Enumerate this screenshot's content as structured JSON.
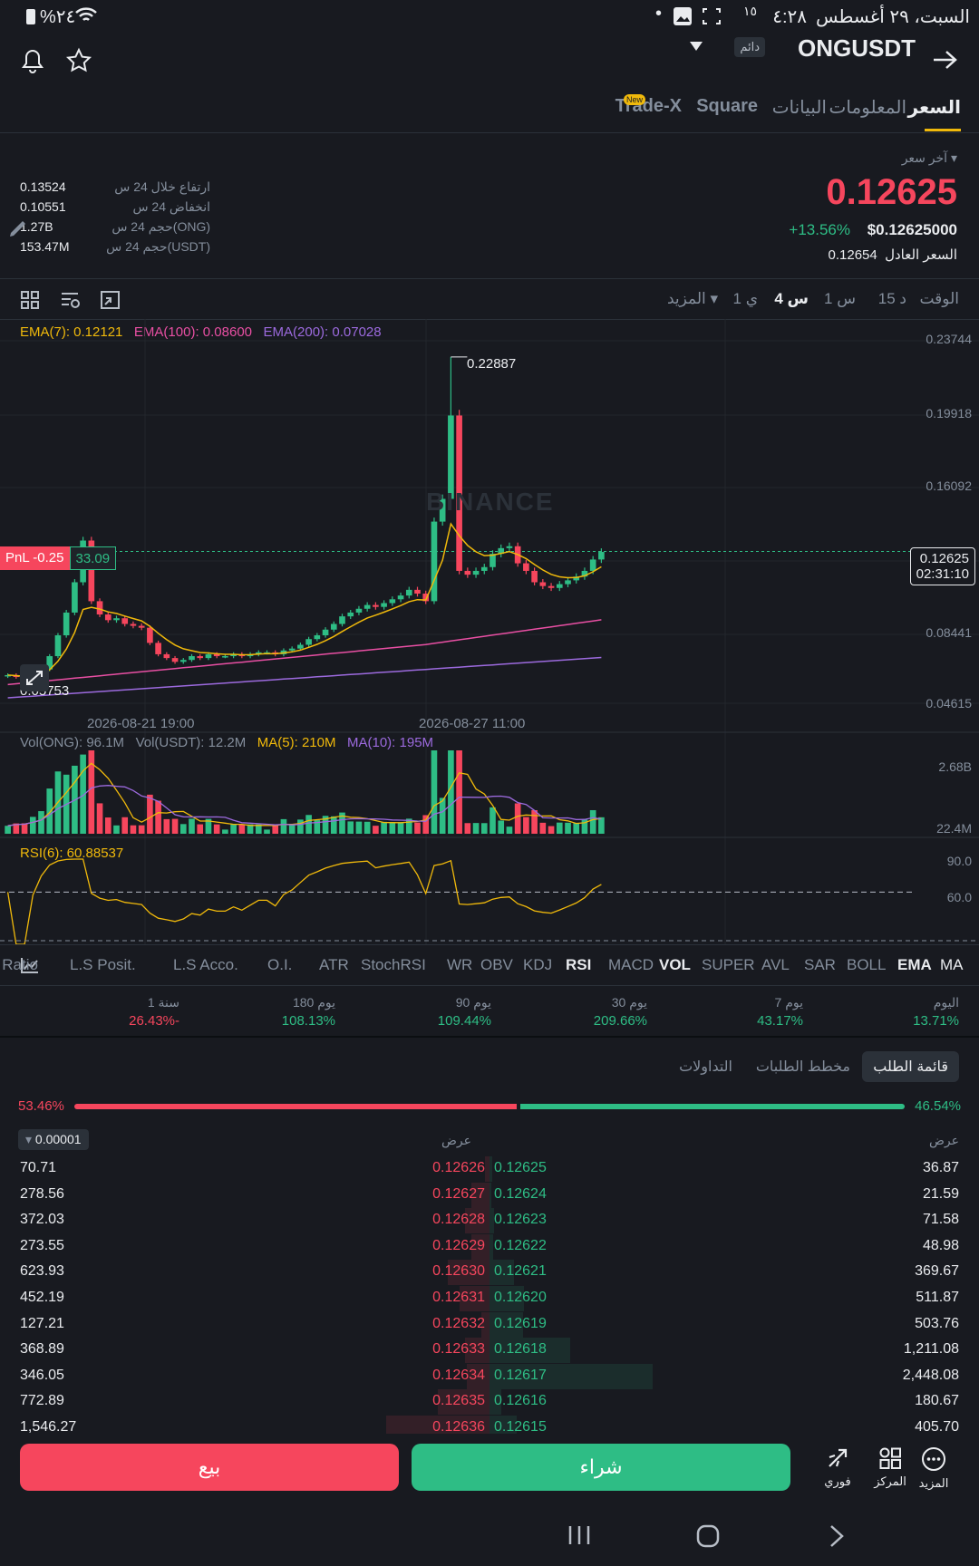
{
  "status_bar": {
    "date": "السبت، ٢٩ أغسطس",
    "time": "٤:٢٨",
    "battery": "%٢٤",
    "sim": "١٥"
  },
  "header": {
    "symbol": "ONGUSDT",
    "badge": "دائم"
  },
  "tabs": [
    {
      "label": "السعر"
    },
    {
      "label": "المعلومات"
    },
    {
      "label": "البيانات"
    },
    {
      "label": "Square"
    },
    {
      "label": "Trade-X",
      "new_badge": "New"
    }
  ],
  "price_panel": {
    "last_price_label": "آخر سعر",
    "last_price": "0.12625",
    "change_pct": "+13.56%",
    "usd_price": "$0.12625000",
    "fair_label": "السعر العادل",
    "fair_price": "0.12654",
    "stats": [
      {
        "label": "ارتفاع خلال 24 س",
        "value": "0.13524"
      },
      {
        "label": "انخفاض 24 س",
        "value": "0.10551"
      },
      {
        "label": "حجم 24 س(ONG)",
        "value": "1.27B"
      },
      {
        "label": "حجم 24 س(USDT)",
        "value": "153.47M"
      }
    ]
  },
  "timeframes": {
    "time_label": "الوقت",
    "items": [
      "15 د",
      "1 س",
      "4 س",
      "1 ي"
    ],
    "active": "4 س",
    "more": "المزيد"
  },
  "chart": {
    "ema_labels": [
      "EMA(7): 0.12121",
      "EMA(100): 0.08600",
      "EMA(200): 0.07028"
    ],
    "y_ticks": [
      "0.23744",
      "0.19918",
      "0.16092",
      "0.08441",
      "0.04615"
    ],
    "high_marker": "0.22887",
    "low_marker": "0.05753",
    "current_price": "0.12625",
    "countdown": "02:31:10",
    "pnl_label": "PnL -0.25",
    "pnl_value": "33.09",
    "x_ticks": [
      "2026-08-21 19:00",
      "2026-08-27 11:00"
    ],
    "watermark": "BINANCE",
    "vol_labels": [
      "Vol(ONG): 96.1M",
      "Vol(USDT): 12.2M",
      "MA(5): 210M",
      "MA(10): 195M"
    ],
    "vol_ticks": [
      "2.68B",
      "22.4M"
    ],
    "rsi_label": "RSI(6): 60.88537",
    "rsi_ticks": [
      "90.0",
      "60.0"
    ]
  },
  "chart_data": {
    "type": "candlestick",
    "ylim": [
      0.04615,
      0.23744
    ],
    "high": 0.22887,
    "low": 0.05753,
    "last": 0.12625,
    "closes": [
      0.061,
      0.06,
      0.059,
      0.061,
      0.064,
      0.071,
      0.082,
      0.094,
      0.11,
      0.132,
      0.1,
      0.093,
      0.09,
      0.091,
      0.088,
      0.087,
      0.086,
      0.078,
      0.072,
      0.07,
      0.068,
      0.069,
      0.071,
      0.07,
      0.072,
      0.071,
      0.071,
      0.072,
      0.071,
      0.072,
      0.073,
      0.073,
      0.072,
      0.074,
      0.075,
      0.077,
      0.08,
      0.082,
      0.085,
      0.088,
      0.092,
      0.094,
      0.096,
      0.098,
      0.097,
      0.099,
      0.101,
      0.103,
      0.106,
      0.104,
      0.1,
      0.142,
      0.154,
      0.198,
      0.116,
      0.114,
      0.116,
      0.118,
      0.125,
      0.128,
      0.129,
      0.12,
      0.116,
      0.11,
      0.108,
      0.107,
      0.109,
      0.111,
      0.113,
      0.116,
      0.122,
      0.126
    ]
  },
  "indicators": [
    "MA",
    "EMA",
    "BOLL",
    "SAR",
    "AVL",
    "SUPER",
    "VOL",
    "MACD",
    "RSI",
    "KDJ",
    "OBV",
    "WR",
    "StochRSI",
    "ATR",
    "O.I.",
    "L.S Acco.",
    "L.S Posit.",
    "L.S Ratio"
  ],
  "performance": [
    {
      "label": "اليوم",
      "value": "13.71%"
    },
    {
      "label": "7 يوم",
      "value": "43.17%"
    },
    {
      "label": "30 يوم",
      "value": "209.66%"
    },
    {
      "label": "90 يوم",
      "value": "109.44%"
    },
    {
      "label": "180 يوم",
      "value": "108.13%"
    },
    {
      "label": "1 سنة",
      "value": "26.43%-"
    }
  ],
  "orderbook_tabs": [
    "قائمة الطلب",
    "مخطط الطلبات",
    "التداولات"
  ],
  "orderbook": {
    "buy_pct": "46.54%",
    "sell_pct": "53.46%",
    "bid_header": "عرض",
    "ask_header": "عرض",
    "tick": "0.00001",
    "rows": [
      {
        "bid_qty": "36.87",
        "bid": "0.12625",
        "ask": "0.12626",
        "ask_qty": "70.71"
      },
      {
        "bid_qty": "21.59",
        "bid": "0.12624",
        "ask": "0.12627",
        "ask_qty": "278.56"
      },
      {
        "bid_qty": "71.58",
        "bid": "0.12623",
        "ask": "0.12628",
        "ask_qty": "372.03"
      },
      {
        "bid_qty": "48.98",
        "bid": "0.12622",
        "ask": "0.12629",
        "ask_qty": "273.55"
      },
      {
        "bid_qty": "369.67",
        "bid": "0.12621",
        "ask": "0.12630",
        "ask_qty": "623.93"
      },
      {
        "bid_qty": "511.87",
        "bid": "0.12620",
        "ask": "0.12631",
        "ask_qty": "452.19"
      },
      {
        "bid_qty": "503.76",
        "bid": "0.12619",
        "ask": "0.12632",
        "ask_qty": "127.21"
      },
      {
        "bid_qty": "1,211.08",
        "bid": "0.12618",
        "ask": "0.12633",
        "ask_qty": "368.89"
      },
      {
        "bid_qty": "2,448.08",
        "bid": "0.12617",
        "ask": "0.12634",
        "ask_qty": "346.05"
      },
      {
        "bid_qty": "180.67",
        "bid": "0.12616",
        "ask": "0.12635",
        "ask_qty": "772.89"
      },
      {
        "bid_qty": "405.70",
        "bid": "0.12615",
        "ask": "0.12636",
        "ask_qty": "1,546.27"
      }
    ]
  },
  "bottom_bar": {
    "sell": "بيع",
    "buy": "شراء",
    "instant": "فوري",
    "center": "المركز",
    "more": "المزيد"
  },
  "colors": {
    "up": "#2ebd85",
    "down": "#f6465d",
    "accent": "#f0b90b",
    "bg": "#181a20"
  }
}
